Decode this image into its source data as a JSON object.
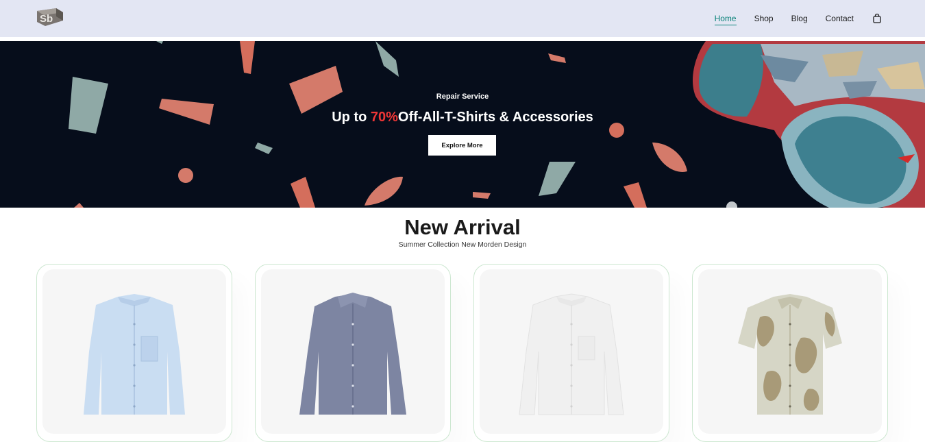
{
  "header": {
    "logo_alt": "Sb",
    "nav": [
      {
        "label": "Home",
        "active": true
      },
      {
        "label": "Shop",
        "active": false
      },
      {
        "label": "Blog",
        "active": false
      },
      {
        "label": "Contact",
        "active": false
      }
    ],
    "cart_icon": "shopping-bag-icon"
  },
  "hero": {
    "subtitle": "Repair Service",
    "title_prefix": "Up to ",
    "title_highlight": "70%",
    "title_suffix": "Off-All-T-Shirts & Accessories",
    "button_label": "Explore More"
  },
  "new_arrival": {
    "title": "New Arrival",
    "subtitle": "Summer Collection New Morden Design",
    "products": [
      {
        "image": "light-blue-shirt"
      },
      {
        "image": "navy-check-shirt"
      },
      {
        "image": "white-shirt"
      },
      {
        "image": "printed-short-sleeve-shirt"
      }
    ]
  },
  "colors": {
    "accent": "#088178",
    "highlight": "#ef3636",
    "header_bg": "#e3e6f3",
    "hero_bg": "#060d1b"
  }
}
